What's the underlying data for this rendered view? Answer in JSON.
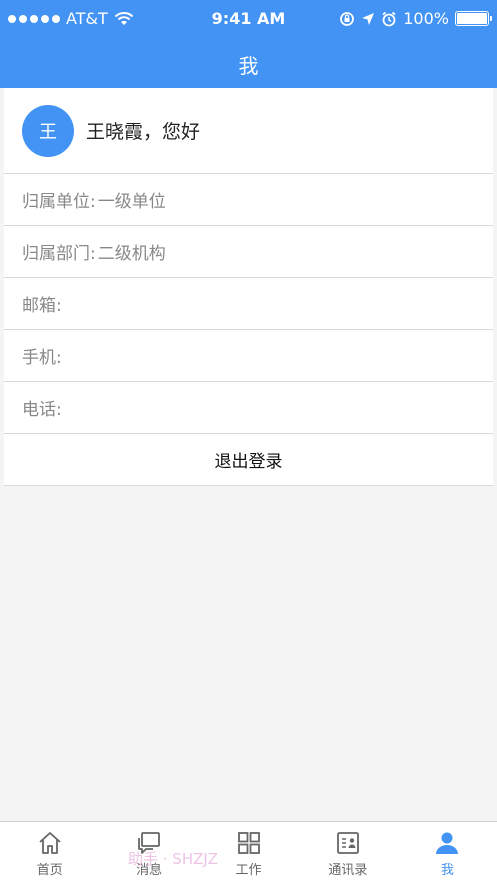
{
  "status_bar": {
    "carrier": "AT&T",
    "time": "9:41 AM",
    "battery": "100%"
  },
  "header": {
    "title": "我"
  },
  "profile": {
    "avatar_text": "王",
    "greeting": "王晓霞，您好"
  },
  "fields": [
    {
      "label": "归属单位:",
      "value": "一级单位"
    },
    {
      "label": "归属部门:",
      "value": "二级机构"
    },
    {
      "label": "邮箱:",
      "value": ""
    },
    {
      "label": "手机:",
      "value": ""
    },
    {
      "label": "电话:",
      "value": ""
    }
  ],
  "logout_label": "退出登录",
  "tabs": [
    {
      "label": "首页",
      "icon": "home-icon"
    },
    {
      "label": "消息",
      "icon": "message-icon"
    },
    {
      "label": "工作",
      "icon": "grid-icon"
    },
    {
      "label": "通讯录",
      "icon": "contacts-icon"
    },
    {
      "label": "我",
      "icon": "user-icon"
    }
  ],
  "active_tab": "我",
  "watermark": "助手 · SHZJZ",
  "colors": {
    "primary": "#4293f4",
    "background": "#f4f4f4",
    "divider": "#d9d9d9"
  }
}
